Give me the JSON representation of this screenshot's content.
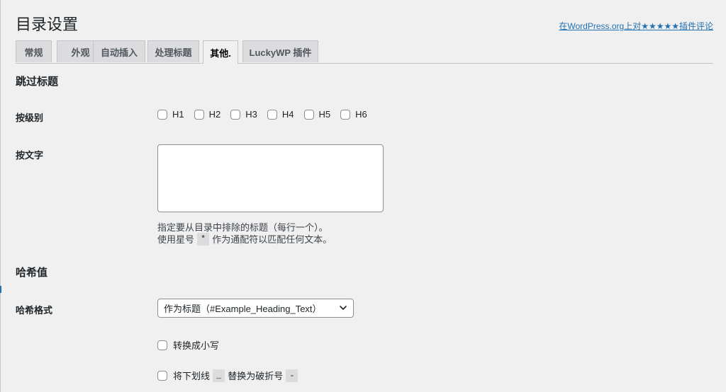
{
  "header": {
    "title": "目录设置",
    "rate_link": "在WordPress.org上对★★★★★插件评论"
  },
  "tabs": [
    {
      "label": "常规"
    },
    {
      "label": "外观"
    },
    {
      "label": "自动插入"
    },
    {
      "label": "处理标题"
    },
    {
      "label": "其他.",
      "active": true
    },
    {
      "label": "LuckyWP 插件"
    }
  ],
  "skip_headings": {
    "section_title": "跳过标题",
    "by_level_label": "按级别",
    "levels": [
      "H1",
      "H2",
      "H3",
      "H4",
      "H5",
      "H6"
    ],
    "by_text_label": "按文字",
    "textarea_value": "",
    "help_line1": "指定要从目录中排除的标题（每行一个）。",
    "help_line2_prefix": "使用星号",
    "help_line2_code": "*",
    "help_line2_suffix": "作为通配符以匹配任何文本。"
  },
  "hash": {
    "section_title": "哈希值",
    "format_label": "哈希格式",
    "format_selected": "作为标题（#Example_Heading_Text）",
    "lowercase_label": "转换成小写",
    "replace_prefix": "将下划线",
    "replace_code1": "_",
    "replace_middle": "替换为破折号",
    "replace_code2": "-"
  },
  "icons": {
    "select_arrow": "chevron-down-icon",
    "resize": "resize-grip-icon"
  },
  "colors": {
    "accent": "#2271b1",
    "background": "#f0f0f1",
    "tab_inactive": "#dcdcde"
  }
}
